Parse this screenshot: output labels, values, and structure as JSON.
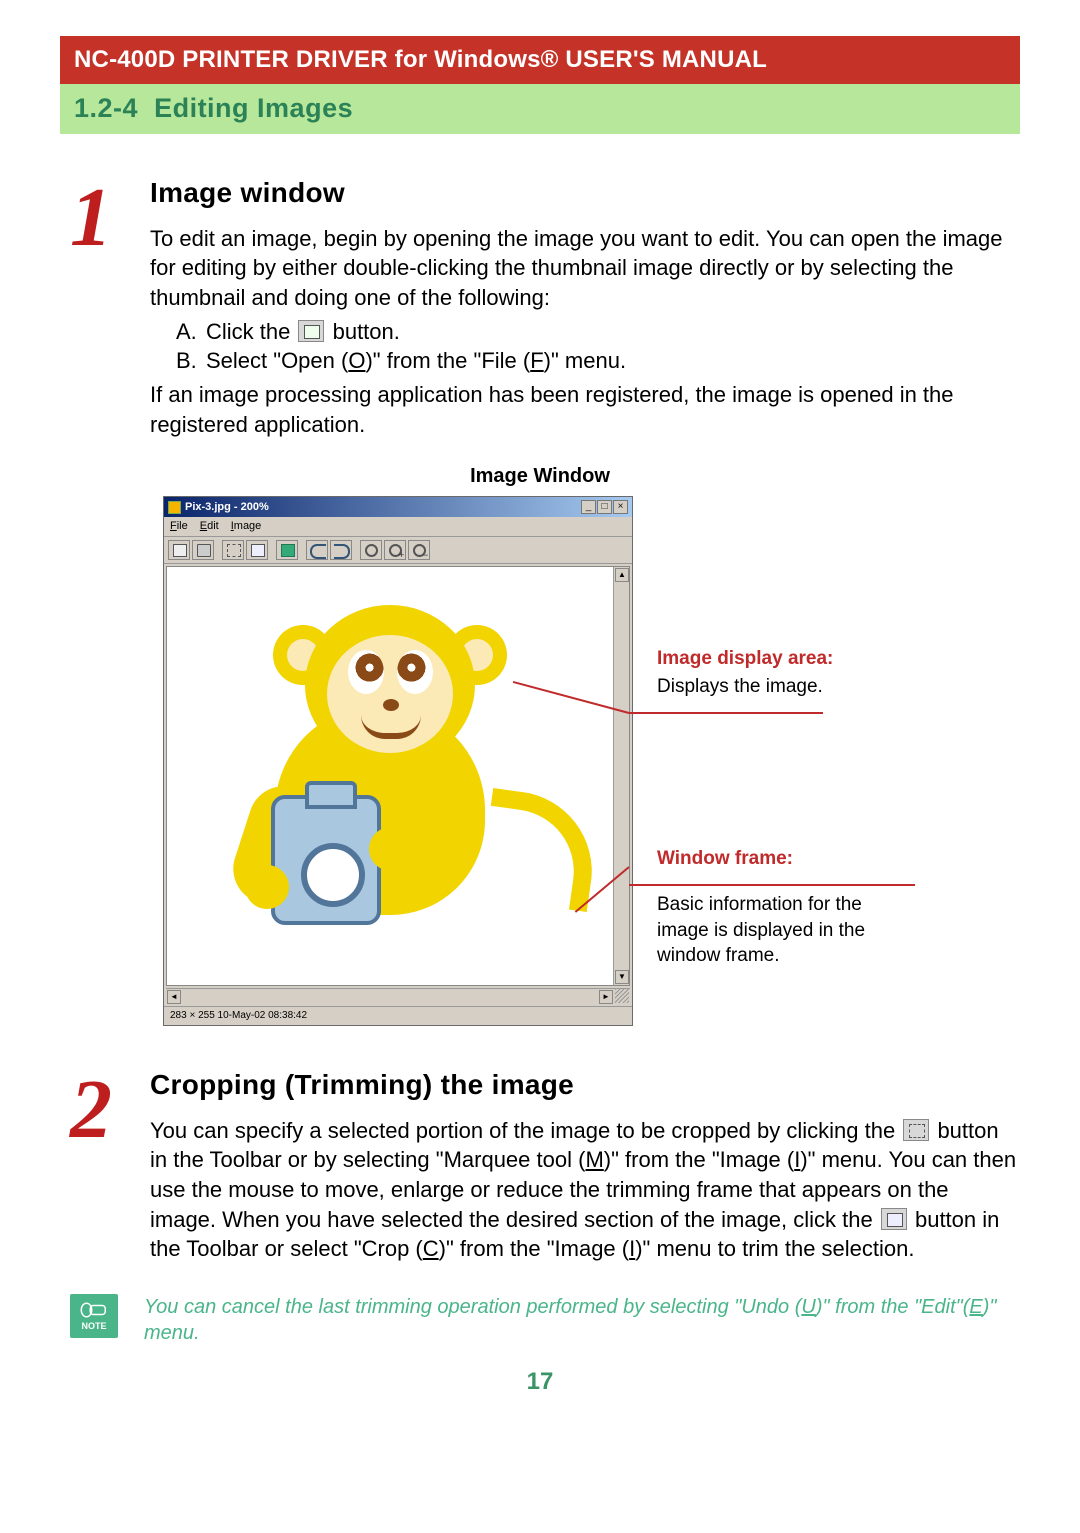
{
  "header": {
    "title": "NC-400D PRINTER DRIVER for Windows® USER'S MANUAL",
    "section_num": "1.2-4",
    "section_title": "Editing Images"
  },
  "step1": {
    "num": "1",
    "title": "Image window",
    "intro": "To edit an image, begin by opening the image you want to edit. You can open the image for editing by either double-clicking the thumbnail image directly or by selecting the thumbnail and doing one of the following:",
    "optA_prefix": "A.",
    "optA_a": "Click the ",
    "optA_b": " button.",
    "optB_prefix": "B.",
    "optB_a": "Select \"Open (",
    "optB_key": "O",
    "optB_b": ")\" from the \"File (",
    "optB_key2": "F",
    "optB_c": ")\" menu.",
    "after": "If an image processing application has been registered, the image is opened in the registered application."
  },
  "figure": {
    "caption": "Image Window",
    "titlebar": "Pix-3.jpg - 200%",
    "menu_file": "File",
    "menu_edit": "Edit",
    "menu_image": "Image",
    "status": "283 × 255   10-May-02 08:38:42",
    "call1_title": "Image display area:",
    "call1_body": "Displays the image.",
    "call2_title": "Window frame:",
    "call2_body": "Basic information for the image is displayed in the window frame."
  },
  "step2": {
    "num": "2",
    "title": "Cropping (Trimming) the image",
    "p_a": "You can specify a selected portion of the image to be cropped by clicking the ",
    "p_b": " button in the Toolbar or by selecting \"Marquee tool (",
    "p_key1": "M",
    "p_c": ")\" from the \"Image (",
    "p_key2": "I",
    "p_d": ")\" menu. You can then use the mouse to move, enlarge or reduce the trimming frame that appears on the image. When you have selected the desired section of the image, click the ",
    "p_e": " button in the Toolbar or select \"Crop (",
    "p_key3": "C",
    "p_f": ")\" from the \"Image (",
    "p_key4": "I",
    "p_g": ")\" menu to trim the selection."
  },
  "note": {
    "label": "NOTE",
    "a": "You can cancel the last trimming operation performed by selecting \"Undo (",
    "key1": "U",
    "b": ")\" from the \"Edit\"(",
    "key2": "E",
    "c": ")\" menu."
  },
  "page_number": "17"
}
